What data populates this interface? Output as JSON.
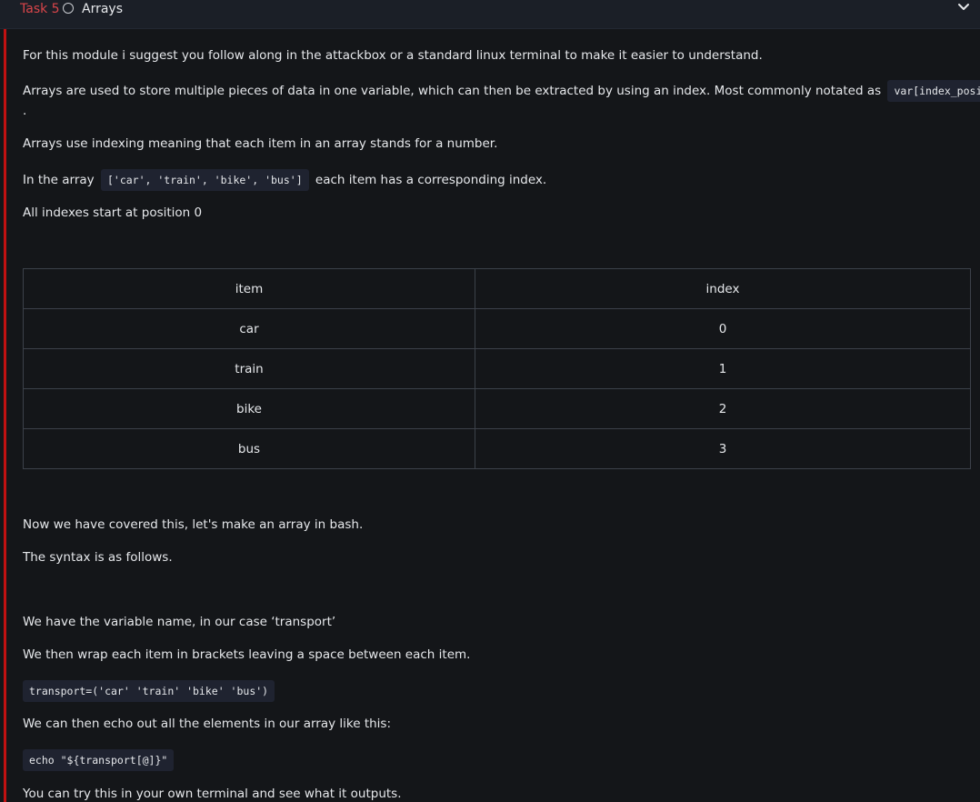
{
  "header": {
    "task_number": "Task 5",
    "title": "Arrays",
    "status_icon": "circle-outline-icon",
    "expand_icon": "chevron-down-icon"
  },
  "content": {
    "accent_color": "#c11111",
    "p1": "For this module i suggest you follow along in the attackbox or a standard linux terminal to make it easier to understand.",
    "p2_text": "Arrays are used to store multiple pieces of data in one variable, which can then be extracted by using an index. Most commonly notated as",
    "p2_code": "var[index_position]",
    "p2_tail": ".",
    "p3": "Arrays use indexing meaning that each item in an array stands for a number.",
    "p4_pre": "In the array",
    "p4_code": "['car', 'train', 'bike', 'bus']",
    "p4_post": "each item has a corresponding index.",
    "p5": "All indexes start at position 0",
    "table": {
      "headers": [
        "item",
        "index"
      ],
      "rows": [
        [
          "car",
          "0"
        ],
        [
          "train",
          "1"
        ],
        [
          "bike",
          "2"
        ],
        [
          "bus",
          "3"
        ]
      ]
    },
    "p6": "Now we have covered this, let's make an array in bash.",
    "p7": "The syntax is as follows.",
    "p8": "We have the variable name, in our case ‘transport’",
    "p9": "We then wrap each item in brackets leaving a space between each item.",
    "code1": "transport=('car' 'train' 'bike' 'bus')",
    "p10": "We can then echo out all the elements in our array like this:",
    "code2": "echo \"${transport[@]}\"",
    "p11": "You can try this in your own terminal and see what it outputs."
  }
}
